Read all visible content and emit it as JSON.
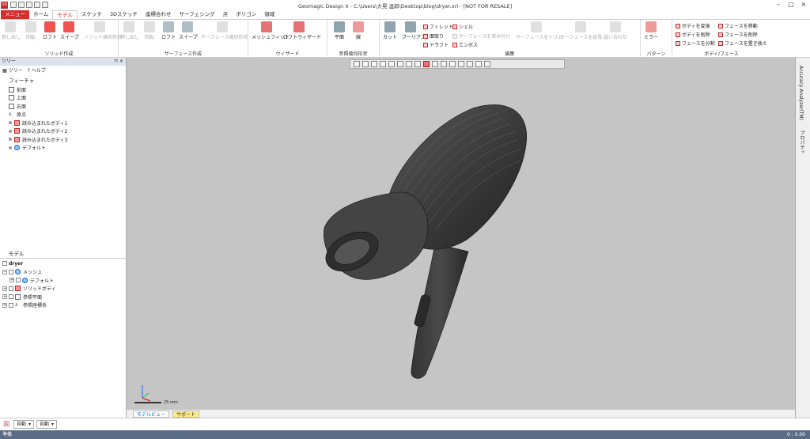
{
  "window": {
    "title": "Geomagic Design X - C:\\Users\\大晃 温郎\\Desktop\\blog\\dryer.xrl - [NOT FOR RESALE]",
    "logo": "DX"
  },
  "menu": {
    "file": "メニュー",
    "tabs": [
      "ホーム",
      "モデル",
      "スケッチ",
      "3Dスケッチ",
      "座標合わせ",
      "サーフェシング",
      "点",
      "ポリゴン",
      "領域"
    ],
    "active_index": 1
  },
  "ribbon": {
    "solid": {
      "title": "ソリッド作成",
      "buttons": [
        "押し出し",
        "回転",
        "ロフト",
        "スイープ",
        "ソリッド幾何形状"
      ]
    },
    "surface": {
      "title": "サーフェース作成",
      "buttons": [
        "押し出し",
        "回転",
        "ロフト",
        "スイープ",
        "サーフェース幾何形状"
      ]
    },
    "wizard": {
      "title": "ウィザード",
      "buttons": [
        "メッシュフィット",
        "ロフトウィザード"
      ]
    },
    "ref": {
      "title": "参照幾何形状",
      "buttons": [
        "平面",
        "線"
      ]
    },
    "edit": {
      "title": "編集",
      "buttons": [
        "カット",
        "ブーリアン"
      ],
      "small": [
        "フィレット",
        "面取り",
        "ドラフト",
        "シェル",
        "サーフェースを厚み付け",
        "エンボス"
      ],
      "disabled": [
        "サーフェースをトリム",
        "サーフェースを延長",
        "縫い合わせ"
      ]
    },
    "pattern": {
      "title": "パターン",
      "buttons": [
        "ミラー"
      ]
    },
    "bodyface": {
      "title": "ボディ/フェース",
      "items": [
        "ボディを変換",
        "ボディを削除",
        "フェースを分割",
        "フェースを移動",
        "フェースを削除",
        "フェースを置き換え"
      ]
    }
  },
  "tree_panel": {
    "title": "ツリー",
    "tabs": [
      "ツリー",
      "ヘルプ"
    ],
    "feature_header": "フィーチャ",
    "features": [
      "前面",
      "上面",
      "右面",
      "原点",
      "読み込まれたボディ1",
      "読み込まれたボディ2",
      "読み込まれたボディ3",
      "デフォルト"
    ],
    "model_header": "モデル",
    "model_items": [
      "dryer",
      "メッシュ",
      "デフォルト",
      "ソリッドボディ",
      "参照平面",
      "参照座標系"
    ]
  },
  "right_tabs": [
    "Accuracy Analyzer(TM)",
    "プロパティ"
  ],
  "bottom_tabs": [
    "モデルビュー",
    "サポート"
  ],
  "selection": {
    "mode1": "自動",
    "mode2": "自動"
  },
  "scale_label": "25 mm",
  "status": {
    "text": "準備",
    "time": "0 : 0.00"
  }
}
